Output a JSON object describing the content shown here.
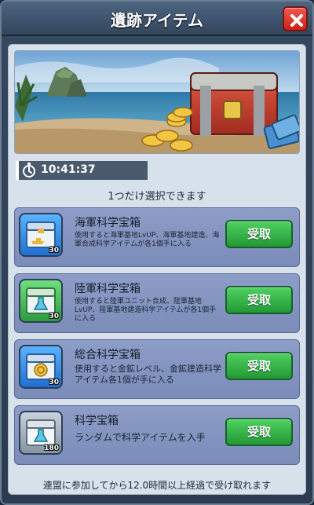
{
  "window": {
    "title": "遺跡アイテム",
    "close_icon": "close-icon"
  },
  "timer": {
    "icon": "stopwatch-icon",
    "value": "10:41:37"
  },
  "instruction": "1つだけ選択できます",
  "rewards": [
    {
      "name": "海軍科学宝箱",
      "description": "使用すると海軍基地LvUP、海軍基地建造、海軍合成科学アイテムが各1個手に入る",
      "quantity": "30",
      "icon": "naval-science-chest-icon",
      "button_label": "受取"
    },
    {
      "name": "陸軍科学宝箱",
      "description": "使用すると陸軍ユニット合成、陸軍基地LvUP、陸軍基地建造科学アイテムが各1個手に入る",
      "quantity": "30",
      "icon": "army-science-chest-icon",
      "button_label": "受取"
    },
    {
      "name": "総合科学宝箱",
      "description": "使用すると金鉱レベル、金鉱建造科学アイテム各1個が手に入る",
      "quantity": "30",
      "icon": "general-science-chest-icon",
      "button_label": "受取"
    },
    {
      "name": "科学宝箱",
      "description": "ランダムで科学アイテムを入手",
      "quantity": "180",
      "icon": "science-chest-icon",
      "button_label": "受取"
    }
  ],
  "footer_note": "連盟に参加してから12.0時間以上経過で受け取れます",
  "colors": {
    "receive_button": "#2fb344",
    "close_button": "#d9362b",
    "card_background": "#8797c2"
  }
}
